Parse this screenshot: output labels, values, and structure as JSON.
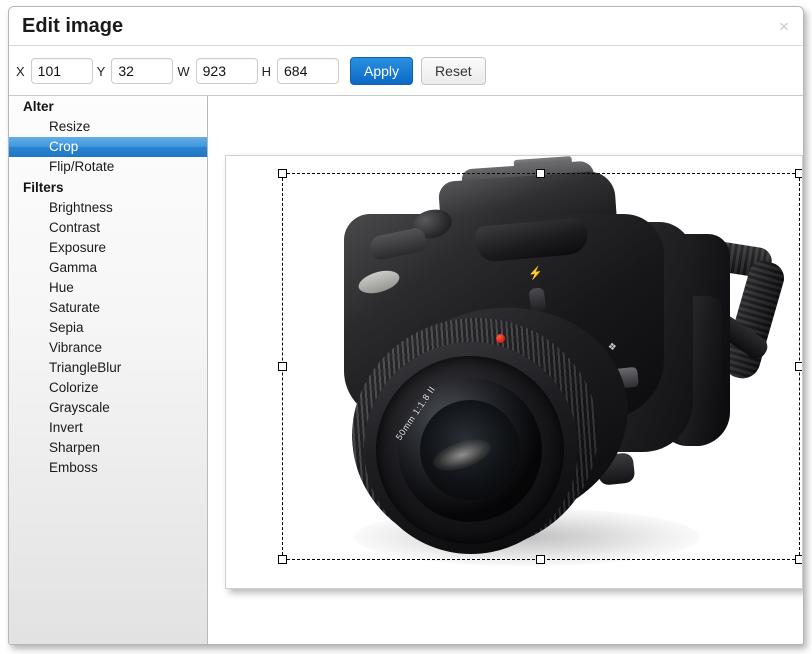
{
  "dialog": {
    "title": "Edit image",
    "close_label": "×"
  },
  "toolbar": {
    "fields": [
      {
        "label": "X",
        "value": "101",
        "name": "x-field"
      },
      {
        "label": "Y",
        "value": "32",
        "name": "y-field"
      },
      {
        "label": "W",
        "value": "923",
        "name": "width-field"
      },
      {
        "label": "H",
        "value": "684",
        "name": "height-field"
      }
    ],
    "apply_label": "Apply",
    "reset_label": "Reset",
    "apply_color": "#1579ce"
  },
  "sidebar": {
    "groups": [
      {
        "title": "Alter",
        "items": [
          {
            "label": "Resize",
            "selected": false
          },
          {
            "label": "Crop",
            "selected": true
          },
          {
            "label": "Flip/Rotate",
            "selected": false
          }
        ]
      },
      {
        "title": "Filters",
        "items": [
          {
            "label": "Brightness",
            "selected": false
          },
          {
            "label": "Contrast",
            "selected": false
          },
          {
            "label": "Exposure",
            "selected": false
          },
          {
            "label": "Gamma",
            "selected": false
          },
          {
            "label": "Hue",
            "selected": false
          },
          {
            "label": "Saturate",
            "selected": false
          },
          {
            "label": "Sepia",
            "selected": false
          },
          {
            "label": "Vibrance",
            "selected": false
          },
          {
            "label": "TriangleBlur",
            "selected": false
          },
          {
            "label": "Colorize",
            "selected": false
          },
          {
            "label": "Grayscale",
            "selected": false
          },
          {
            "label": "Invert",
            "selected": false
          },
          {
            "label": "Sharpen",
            "selected": false
          },
          {
            "label": "Emboss",
            "selected": false
          }
        ]
      }
    ],
    "selection_color": "#2f8ad6"
  },
  "canvas": {
    "photo_subject": "dslr-camera-with-50mm-lens",
    "lens_marking": "50mm 1:1.8  II",
    "crop_selection": {
      "visible": true,
      "handles": [
        "nw",
        "n",
        "ne",
        "w",
        "e",
        "sw",
        "s",
        "se"
      ],
      "border_style": "dashed",
      "border_color": "#000000"
    }
  }
}
